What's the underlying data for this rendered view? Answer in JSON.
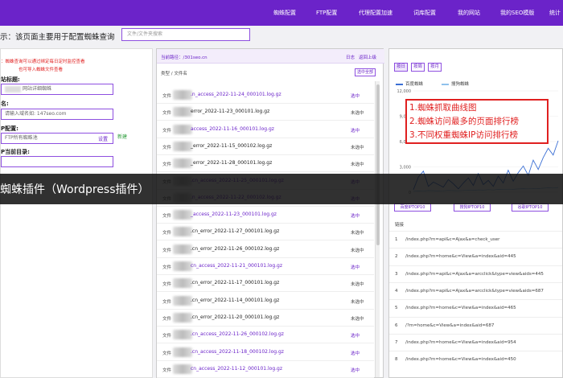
{
  "nav": {
    "items": [
      "蜘蛛配置",
      "FTP配置",
      "代理配置加速",
      "词库配置",
      "我的网站",
      "我的SEO模版",
      "统计"
    ]
  },
  "header": {
    "title": "示：该页面主要用于配置蜘蛛查询",
    "search_placeholder": "文件/文件夹搜索"
  },
  "left": {
    "note_line1": "：蜘蛛查询可以通过绑定每日定时监控查看",
    "note_line2": "也可导入蜘蛛文件查看",
    "site_title_label": "站标题:",
    "site_title_value": "网站详细蜘蛛",
    "domain_label": "名:",
    "domain_placeholder": "请输入域名如: 147seo.com",
    "ftp_label": "P配置:",
    "ftp_value": "FTP所有蜘蛛池",
    "settings_link": "设置",
    "new_link": "新建",
    "dir_label": "P当前目录:"
  },
  "files": {
    "path": "当前路径：/301seo.cn",
    "log_link": "日志",
    "back_link": "返回上级",
    "col_header": "类型 / 文件名",
    "select_all": "选中全部",
    "rows": [
      {
        "type": "文件",
        "name": ".n_access_2022-11-24_000101.log.gz",
        "status": "选中",
        "selected": true
      },
      {
        "type": "文件",
        "name": "error_2022-11-23_000101.log.gz",
        "status": "未选中",
        "selected": false
      },
      {
        "type": "文件",
        "name": "access_2022-11-16_000101.log.gz",
        "status": "选中",
        "selected": true
      },
      {
        "type": "文件",
        "name": "_error_2022-11-15_000102.log.gz",
        "status": "未选中",
        "selected": false
      },
      {
        "type": "文件",
        "name": "_error_2022-11-28_000101.log.gz",
        "status": "未选中",
        "selected": false
      },
      {
        "type": "文件",
        "name": ".cn_access_2022-11-25_000101.log.gz",
        "status": "选中",
        "selected": true
      },
      {
        "type": "文件",
        "name": ".n_access_2022-11-22_000102.log.gz",
        "status": "选中",
        "selected": true
      },
      {
        "type": "文件",
        "name": "_access_2022-11-23_000101.log.gz",
        "status": "选中",
        "selected": true
      },
      {
        "type": "文件",
        "name": ".cn_error_2022-11-27_000101.log.gz",
        "status": "未选中",
        "selected": false
      },
      {
        "type": "文件",
        "name": ".cn_error_2022-11-26_000102.log.gz",
        "status": "未选中",
        "selected": false
      },
      {
        "type": "文件",
        "name": "cn_access_2022-11-21_000101.log.gz",
        "status": "选中",
        "selected": true
      },
      {
        "type": "文件",
        "name": ".cn_error_2022-11-17_000101.log.gz",
        "status": "未选中",
        "selected": false
      },
      {
        "type": "文件",
        "name": ".cn_error_2022-11-14_000101.log.gz",
        "status": "未选中",
        "selected": false
      },
      {
        "type": "文件",
        "name": ".cn_error_2022-11-20_000101.log.gz",
        "status": "未选中",
        "selected": false
      },
      {
        "type": "文件",
        "name": ".cn_access_2022-11-26_000102.log.gz",
        "status": "选中",
        "selected": true
      },
      {
        "type": "文件",
        "name": ".cn_access_2022-11-18_000102.log.gz",
        "status": "选中",
        "selected": true
      },
      {
        "type": "文件",
        "name": "cn_access_2022-11-12_000101.log.gz",
        "status": "选中",
        "selected": true
      }
    ]
  },
  "chart": {
    "tabs": [
      "按日",
      "按周",
      "按月"
    ],
    "legend": [
      "百度蜘蛛",
      "搜狗蜘蛛"
    ],
    "colors": {
      "baidu": "#3b6fd4",
      "sogou": "#8fc1ec",
      "accent": "#6b23c9",
      "annotation": "#e02020"
    },
    "annotation_lines": [
      "1.蜘蛛抓取曲线图",
      "2.蜘蛛访问最多的页面排行榜",
      "3.不同权重蜘蛛IP访问排行榜"
    ]
  },
  "chart_data": {
    "type": "line",
    "ylim": [
      0,
      12000
    ],
    "yticks": [
      "12,000",
      "9,000",
      "6,000",
      "3,000",
      "0"
    ],
    "series": [
      {
        "name": "百度蜘蛛",
        "values": [
          300,
          1800,
          2500,
          700,
          1200,
          900,
          600,
          1500,
          1000,
          400,
          1100,
          1700,
          800,
          2200,
          900,
          1400,
          700,
          1900,
          1100,
          2600,
          1300,
          2300,
          3100,
          2000,
          3800,
          2700,
          4100,
          5200,
          4400,
          6100
        ]
      },
      {
        "name": "搜狗蜘蛛",
        "values": [
          100,
          150,
          120,
          200,
          180,
          140,
          160,
          220,
          190,
          170,
          210,
          260,
          230,
          280,
          250,
          300,
          270,
          330,
          310,
          360,
          340,
          390,
          420,
          400,
          450,
          430,
          480,
          520,
          500,
          560
        ]
      }
    ]
  },
  "ranks": {
    "tabs": [
      "百度IPTOP10",
      "搜狗IPTOP10",
      "谷歌IPTOP10"
    ],
    "url_header": "链接",
    "rows": [
      {
        "n": "1",
        "url": "/index.php?m=api&c=Ajax&a=check_user"
      },
      {
        "n": "2",
        "url": "/index.php?m=home&c=View&a=index&aid=445"
      },
      {
        "n": "3",
        "url": "/index.php?m=api&c=Ajax&a=arcclick&type=view&aids=445"
      },
      {
        "n": "4",
        "url": "/index.php?m=api&c=Ajax&a=arcclick&type=view&aids=687"
      },
      {
        "n": "5",
        "url": "/index.php?m=home&c=View&a=index&aid=465"
      },
      {
        "n": "6",
        "url": "/?m=home&c=View&a=index&aid=687"
      },
      {
        "n": "7",
        "url": "/index.php?m=home&c=View&a=index&aid=954"
      },
      {
        "n": "8",
        "url": "/index.php?m=home&c=View&a=index&aid=450"
      }
    ]
  },
  "banner": {
    "text": "蜘蛛插件（Wordpress插件）"
  }
}
